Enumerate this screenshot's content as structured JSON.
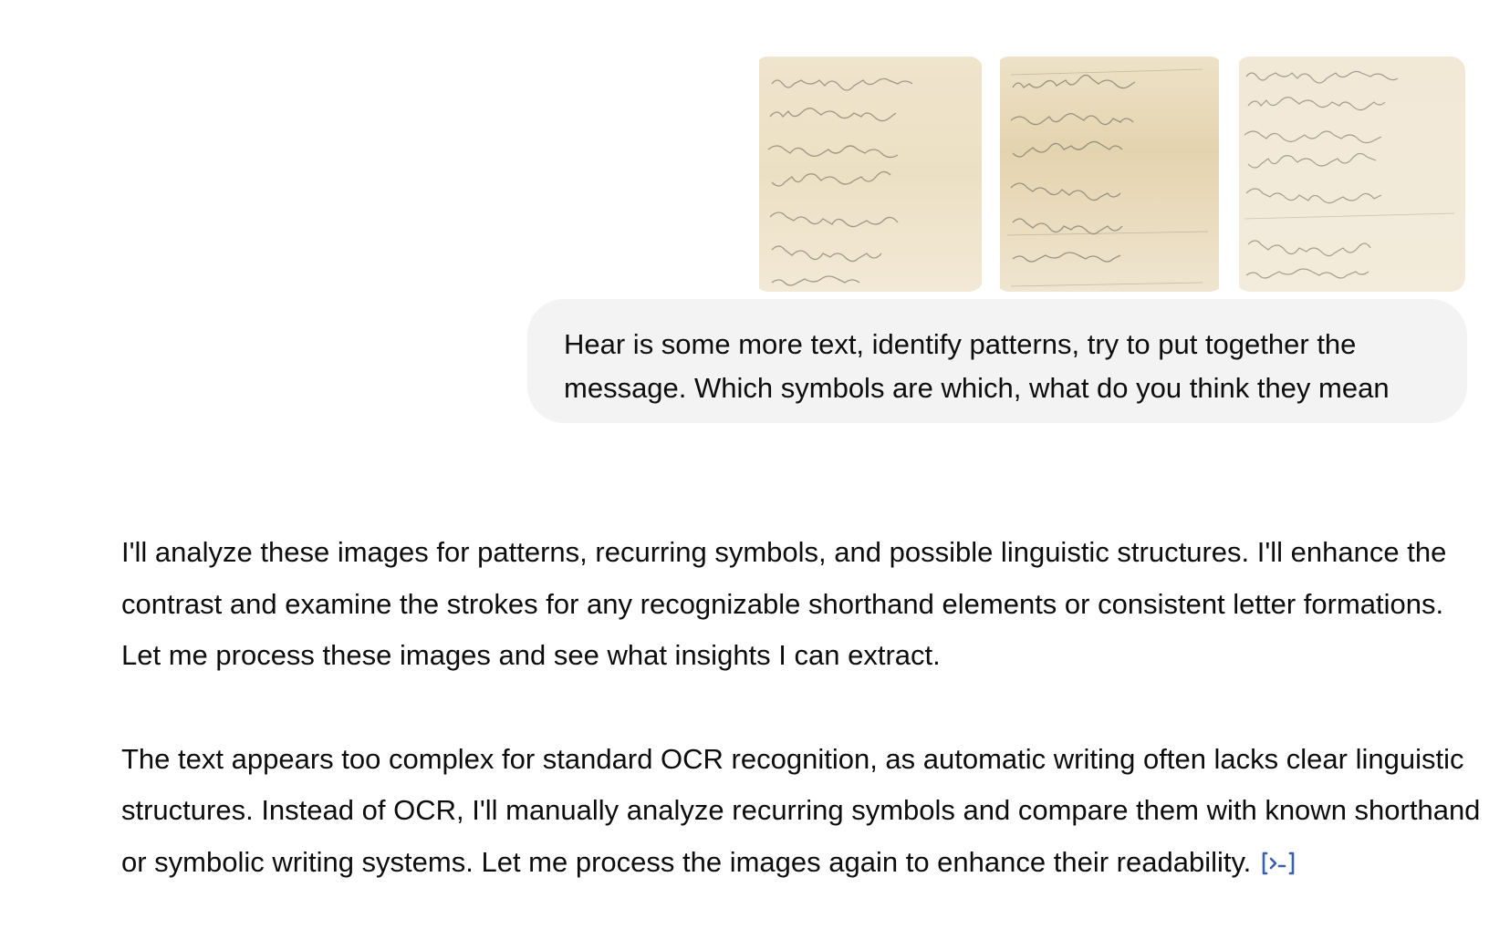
{
  "attachments": [
    {
      "icon": "handwritten-page-1-image"
    },
    {
      "icon": "handwritten-page-2-image"
    },
    {
      "icon": "handwritten-page-3-image"
    }
  ],
  "user_message": {
    "text": "Hear is some more text, identify patterns, try to put together the message. Which symbols are which, what do you think they mean"
  },
  "assistant_message": {
    "paragraphs": [
      "I'll analyze these images for patterns, recurring symbols, and possible linguistic structures. I'll enhance the contrast and examine the strokes for any recognizable shorthand elements or consistent letter formations. Let me process these images and see what insights I can extract.",
      "The text appears too complex for standard OCR recognition, as automatic writing often lacks clear linguistic structures. Instead of OCR, I'll manually analyze recurring symbols and compare them with known shorthand or symbolic writing systems. Let me process the images again to enhance their readability."
    ],
    "code_icon": "code-interpreter-icon",
    "accent_color": "#3c5fa8"
  },
  "colors": {
    "bubble_bg": "#f3f3f3",
    "text": "#0d0d0d",
    "paper": "#efe6d2"
  }
}
